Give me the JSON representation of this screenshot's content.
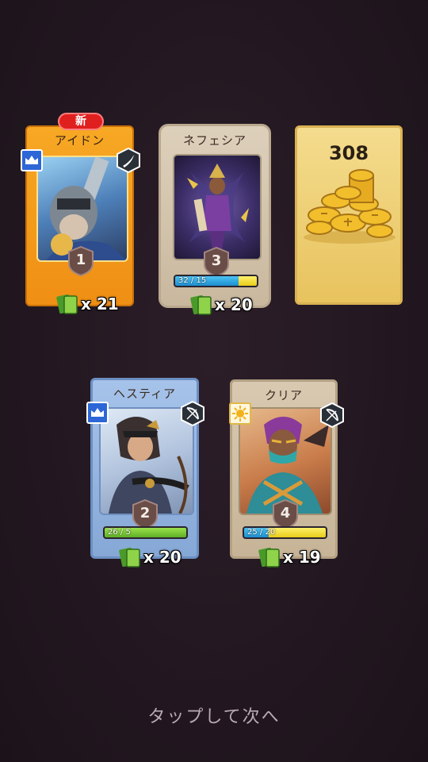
{
  "cards": [
    {
      "name": "アイドン",
      "level": "1",
      "shards": "x 21",
      "new_label": "新",
      "class_icon": "crown-icon",
      "role_icon": "sword-icon",
      "rarity_color": "#f29a1c"
    },
    {
      "name": "ネフェシア",
      "level": "3",
      "shards": "x 20",
      "progress_text": "32 / 15",
      "progress": 1.0,
      "rarity_color": "#d8c7ad"
    },
    {
      "name": "ヘスティア",
      "level": "2",
      "shards": "x 20",
      "progress_text": "26 / 5",
      "progress": 1.0,
      "class_icon": "crown-icon",
      "role_icon": "bow-icon",
      "rarity_color": "#8fb3e0"
    },
    {
      "name": "クリア",
      "level": "4",
      "shards": "x 19",
      "progress_text": "25 / 20",
      "progress": 1.0,
      "class_icon": "sun-icon",
      "role_icon": "bow-icon",
      "rarity_color": "#d8c7ad"
    }
  ],
  "coins": {
    "amount": "308",
    "icon": "gold-coins-icon"
  },
  "footer": {
    "tap_text": "タップして次へ"
  }
}
